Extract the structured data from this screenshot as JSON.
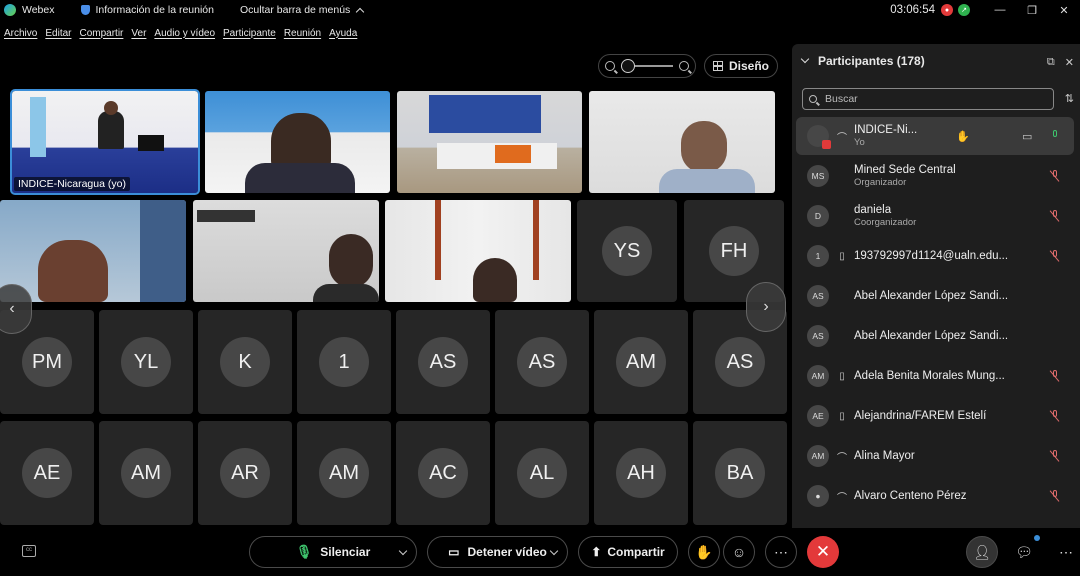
{
  "titlebar": {
    "app_name": "Webex",
    "meeting_info": "Información de la reunión",
    "hide_menu": "Ocultar barra de menús",
    "clock": "03:06:54"
  },
  "menu": [
    "Archivo",
    "Editar",
    "Compartir",
    "Ver",
    "Audio y vídeo",
    "Participante",
    "Reunión",
    "Ayuda"
  ],
  "stage": {
    "layout_label": "Diseño",
    "self_label": "INDICE-Nicaragua (yo)",
    "row2_avatars": [
      "YS",
      "FH"
    ],
    "row3_avatars": [
      "PM",
      "YL",
      "K",
      "1",
      "AS",
      "AS",
      "AM",
      "AS"
    ],
    "row4_avatars": [
      "AE",
      "AM",
      "AR",
      "AM",
      "AC",
      "AL",
      "AH",
      "BA"
    ]
  },
  "panel": {
    "title": "Participantes (178)",
    "search_placeholder": "Buscar",
    "participants": [
      {
        "initials": "",
        "name": "INDICE-Ni...",
        "role": "Yo"
      },
      {
        "initials": "MS",
        "name": "Mined Sede Central",
        "role": "Organizador"
      },
      {
        "initials": "D",
        "name": "daniela",
        "role": "Coorganizador"
      },
      {
        "initials": "1",
        "name": "193792997d1124@ualn.edu...",
        "role": ""
      },
      {
        "initials": "AS",
        "name": "Abel Alexander López Sandi...",
        "role": ""
      },
      {
        "initials": "AS",
        "name": "Abel Alexander López Sandi...",
        "role": ""
      },
      {
        "initials": "AM",
        "name": "Adela Benita Morales Mung...",
        "role": ""
      },
      {
        "initials": "AE",
        "name": "Alejandrina/FAREM Estelí",
        "role": ""
      },
      {
        "initials": "AM",
        "name": "Alina Mayor",
        "role": ""
      },
      {
        "initials": "",
        "name": "Álvaro Centeno Pérez",
        "role": ""
      }
    ]
  },
  "controls": {
    "mute": "Silenciar",
    "stop_video": "Detener vídeo",
    "share": "Compartir"
  }
}
